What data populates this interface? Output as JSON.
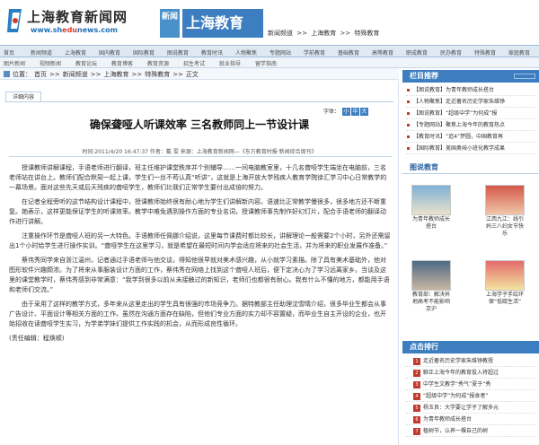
{
  "header": {
    "logo_name": "上海教育新闻网",
    "logo_url_prefix": "www.sh",
    "logo_url_highlight": "edu",
    "logo_url_suffix": "news.com",
    "news_badge": "新闻",
    "site_title": "上海教育",
    "breadcrumb": [
      "新闻频道",
      ">>",
      "上海教育",
      ">>",
      "特殊教育"
    ]
  },
  "location": {
    "label": "位置：",
    "items": [
      "首页",
      ">>",
      "新闻频道",
      ">>",
      "上海教育",
      ">>",
      "特殊教育",
      ">>",
      "正文"
    ]
  },
  "article": {
    "tab_label": "详细内容",
    "font_label": "字体：",
    "font_sizes": [
      "小",
      "中",
      "大"
    ],
    "title": "确保聋哑人听课效率 三名教师同上一节设计课",
    "meta": "时间:2011/4/20 16:47:37 作者：戴 雯 来源：上海教育新闻网—《东方教育时报·新闻综合周刊》",
    "paragraphs": [
      "授课教师讲解课程，手语老师进行翻译，班主任维护课堂秩序并个别辅导……一间电脑教室里，十几名聋哑学生端坐在电脑前，三名老师站在讲台上。教师们配合默契一起上课，学生们一丝不苟认真“听讲”，这就是上海开放大学残疾人教育学院徐汇学习中心日常教学的一幕场景。面对这些先天或后天残疾的聋哑学生，教师们比我们正常学生要付出成倍的努力。",
      "在记者全程旁听的这节结构设计课程中，授课教师始终很有耐心地为学生们讲解新内容。语速比正常教学慢很多，很多地方还不断重复。她表示，这样更能保证学生的听课效率。教学中难免遇到操作方面的专业名词，授课教师事先制作好幻灯片，配合手语老师的翻译动作进行讲解。",
      "注重操作环节是聋哑人班的另一大特色。手语教师任佩娜介绍说，这里每节课费时都比较长，讲解理论一般需要2个小时，另外还需留出1个小时给学生进行操作实训。“聋哑学生在这里学习，就是希望在最短时间内学会适应将来的社会生活，并为将来的职业发展作准备。”",
      "蔡伟秀同学来自浙江温州，记者通过手语老师与他交谈，得知他很早就对美术感兴趣，从小就学习素描。除了具有美术基础外，他对图形软件兴趣颇浓。为了将来从事服装设计方面的工作，蔡伟秀在网络上找到这个聋哑人班后，便下定决心为了学习远离家乡。当谈及这里的课堂教学时，蔡伟秀感到非常满意：“我学到很多以前从未接触过的新知识，老师们也都很有耐心。我有什么不懂的地方，都能用手语和老师们交流。”",
      "由于采用了这样的教学方式，多年来从这里走出的学生具有很强的市场竞争力。据特教部主任助理沈雪晴介绍，很多毕业生都会从事广告设计、平面设计等相关方面的工作。虽然在沟通方面存在缺陷，但他们专业方面的实力却不容置疑，而毕业生自主开设的企业，也开始招收在读聋哑学生实习，为学弟学妹们提供工作实践的机会，从而形成良性循环。",
      "(责任编辑：程焕顺)"
    ]
  },
  "sidebar": {
    "column_title": "栏目推荐",
    "column_items": [
      "【图说教育】为青年教师成长搭台",
      "【人物聚焦】走近著名历史学家朱维铮",
      "【图说教育】“超级中学”为何成“报",
      "【专题网站】聚焦上海今年的教育热点",
      "【教育时讯】“追4”梦圆，中国教育再",
      "【国际教育】美国奥岐小班化教学成果"
    ],
    "pic_title": "图说教育",
    "pics": [
      "为青年教师成长搭台",
      "江西九江：线引妈三八妇女节快乐",
      "教育部：解决异地高考不能影响京沪",
      "上海学子手绘环保“低碳生活”"
    ],
    "hot_title": "点击排行",
    "hot_items": [
      "走近著名历史学家朱维铮教授",
      "聊正上海今年的教育投入将超过",
      "中学生文教学“秀气”夏于“秀",
      "“超级中学”为何成“报食者”",
      "杨玉良：大学要让学子了解多元",
      "为青年教师成长搭台",
      "植树节，认养一棵自己的树"
    ]
  },
  "nav": {
    "row1": [
      "首页",
      "新闻频道",
      "上海教育",
      "国内教育",
      "国际教育",
      "图说教育",
      "教育时讯",
      "人物聚焦",
      "专题网站",
      "学前教育",
      "基础教育",
      "高等教育",
      "职成教育",
      "民办教育",
      "特殊教育",
      "家庭教育"
    ],
    "row2": [
      "图片新闻",
      "视频新闻",
      "教育论坛",
      "教育博客",
      "教育资源",
      "招生考试",
      "就业指导",
      "留学指南"
    ]
  },
  "colors": {
    "accent": "#3c7ec0",
    "red": "#c23a2b"
  }
}
